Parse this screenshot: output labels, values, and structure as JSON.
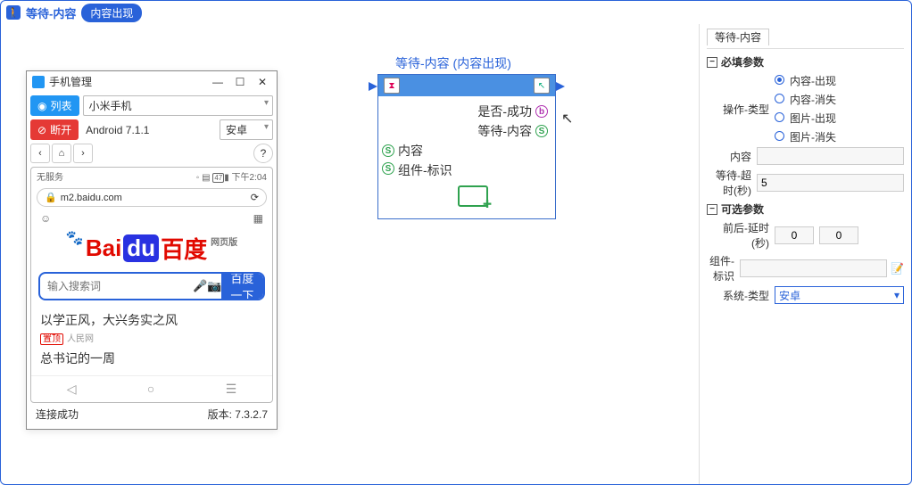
{
  "topbar": {
    "title": "等待-内容",
    "pill": "内容出现"
  },
  "phone": {
    "title": "手机管理",
    "list_btn": "列表",
    "device": "小米手机",
    "disconnect_btn": "断开",
    "android_ver": "Android 7.1.1",
    "platform": "安卓",
    "status_left": "无服务",
    "status_right": "下午2:04",
    "status_battery": "47",
    "url": "m2.baidu.com",
    "logo_bai": "Bai",
    "logo_du": "du",
    "logo_cn": "百度",
    "logo_wyb": "网页版",
    "search_placeholder": "输入搜索词",
    "search_btn": "百度一下",
    "news1": "以学正风，大兴务实之风",
    "news1_tag": "置顶",
    "news1_src": "人民网",
    "news2": "总书记的一周",
    "conn_status": "连接成功",
    "version_label": "版本: 7.3.2.7"
  },
  "node": {
    "label": "等待-内容 (内容出现)",
    "out_success": "是否-成功",
    "out_wait": "等待-内容",
    "in_content": "内容",
    "in_component": "组件-标识"
  },
  "side": {
    "tab": "等待-内容",
    "sec1": "必填参数",
    "op_label": "操作-类型",
    "op1": "内容-出现",
    "op2": "内容-消失",
    "op3": "图片-出现",
    "op4": "图片-消失",
    "content_label": "内容",
    "content_value": "",
    "timeout_label": "等待-超时(秒)",
    "timeout_value": "5",
    "sec2": "可选参数",
    "delay_label": "前后-延时(秒)",
    "delay_before": "0",
    "delay_after": "0",
    "comp_label": "组件-标识",
    "comp_value": "",
    "sys_label": "系统-类型",
    "sys_value": "安卓"
  }
}
